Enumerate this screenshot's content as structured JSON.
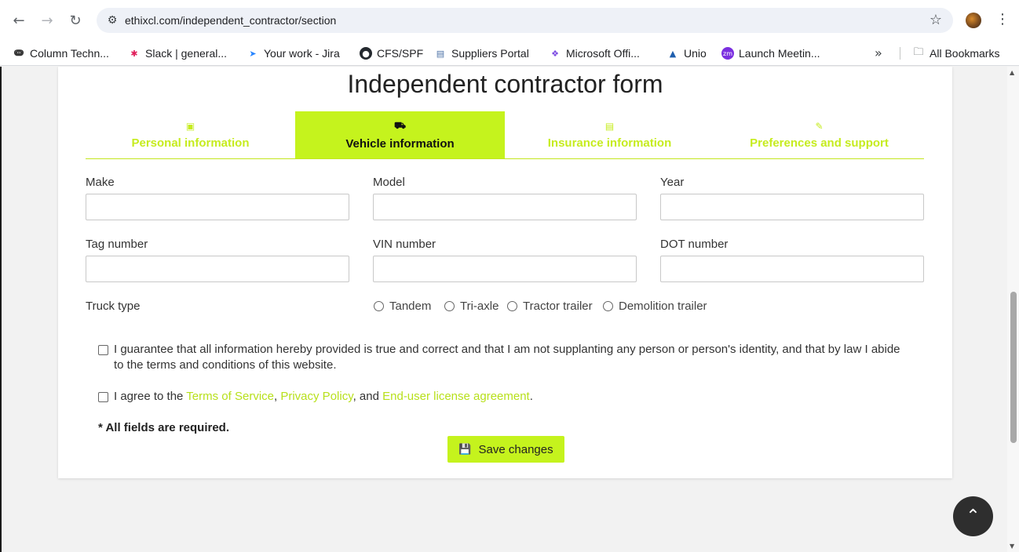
{
  "browser": {
    "url": "ethixcl.com/independent_contractor/section",
    "bookmarks": [
      {
        "label": "Column Techn...",
        "icon": "column-icon",
        "color": "#333333"
      },
      {
        "label": "Slack | general...",
        "icon": "slack-icon",
        "color": "#e01e5a"
      },
      {
        "label": "Your work - Jira",
        "icon": "jira-icon",
        "color": "#2684ff"
      },
      {
        "label": "CFS/SPF",
        "icon": "github-icon",
        "color": "#24292f"
      },
      {
        "label": "Suppliers Portal",
        "icon": "portal-icon",
        "color": "#4a6fa5"
      },
      {
        "label": "Microsoft Offi...",
        "icon": "microsoft-icon",
        "color": "#7b4ae2"
      },
      {
        "label": "Unio",
        "icon": "unio-icon",
        "color": "#1f5fae"
      },
      {
        "label": "Launch Meetin...",
        "icon": "zoom-icon",
        "color": "#7b2fe0"
      }
    ],
    "all_bookmarks_label": "All Bookmarks"
  },
  "form": {
    "title": "Independent contractor form",
    "tabs": [
      {
        "label": "Personal information",
        "icon": "id-card-icon",
        "active": false
      },
      {
        "label": "Vehicle information",
        "icon": "truck-icon",
        "active": true
      },
      {
        "label": "Insurance information",
        "icon": "document-icon",
        "active": false
      },
      {
        "label": "Preferences and support",
        "icon": "paperclip-icon",
        "active": false
      }
    ],
    "fields": {
      "make": {
        "label": "Make",
        "value": ""
      },
      "model": {
        "label": "Model",
        "value": ""
      },
      "year": {
        "label": "Year",
        "value": ""
      },
      "tag_number": {
        "label": "Tag number",
        "value": ""
      },
      "vin_number": {
        "label": "VIN number",
        "value": ""
      },
      "dot_number": {
        "label": "DOT number",
        "value": ""
      }
    },
    "truck_type": {
      "label": "Truck type",
      "options": [
        "Tandem",
        "Tri-axle",
        "Tractor trailer",
        "Demolition trailer"
      ]
    },
    "guarantee_text": "I guarantee that all information hereby provided is true and correct and that I am not supplanting any person or person's identity, and that by law I abide to the terms and conditions of this website.",
    "agree": {
      "prefix": "I agree to the ",
      "terms": "Terms of Service",
      "comma": ", ",
      "privacy": "Privacy Policy",
      "and": ", and ",
      "eula": "End-user license agreement",
      "suffix": "."
    },
    "required_note": "* All fields are required.",
    "save_label": "Save changes"
  },
  "colors": {
    "accent": "#c5f31d",
    "accent_text": "#c6ec1f",
    "back_to_top": "#2e2e2e"
  }
}
